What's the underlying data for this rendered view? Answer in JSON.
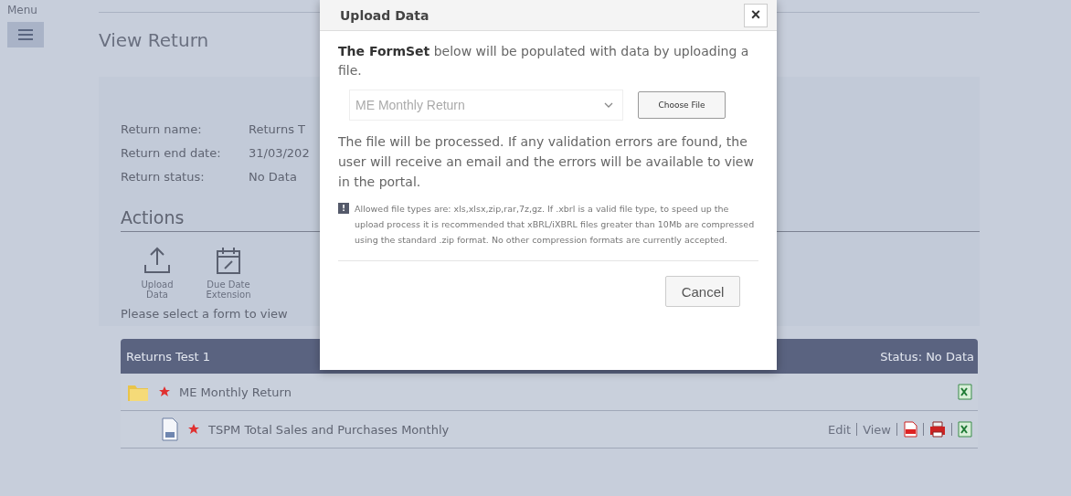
{
  "menu": {
    "label": "Menu"
  },
  "page": {
    "title": "View Return"
  },
  "details": [
    {
      "label": "Return name:",
      "value": "Returns T"
    },
    {
      "label": "Return end date:",
      "value": "31/03/202"
    },
    {
      "label": "Return status:",
      "value": "No Data"
    }
  ],
  "actions": {
    "title": "Actions",
    "items": [
      {
        "kind": "upload",
        "label": "Upload Data"
      },
      {
        "kind": "calendar",
        "label": "Due Date Extension"
      }
    ]
  },
  "prompt": "Please select a form to view",
  "formset": {
    "name": "Returns Test 1",
    "status": "Status: No Data",
    "rows": [
      {
        "kind": "folder",
        "name": "ME Monthly Return",
        "links": [],
        "exports": [
          {
            "kind": "excel"
          }
        ],
        "children": [
          {
            "kind": "document",
            "name": "TSPM Total Sales and Purchases Monthly",
            "links": [
              "Edit",
              "View"
            ],
            "exports": [
              {
                "kind": "pdf"
              },
              {
                "kind": "print"
              },
              {
                "kind": "excel"
              }
            ]
          }
        ]
      }
    ]
  },
  "dialog": {
    "title": "Upload Data",
    "close": "×",
    "intro": "**The FormSet** below will be populated with data by uploading a file.",
    "select": {
      "value": "ME Monthly Return"
    },
    "choose_button": "Choose File",
    "message": "The file will be processed. If any validation errors are found, the user will receive an email and the errors will be available to view in the portal.",
    "note_icon": "!",
    "note": "Allowed file types are: xls,xlsx,zip,rar,7z,gz. If .xbrl is a valid file type, to speed up the upload process it is recommended that xBRL/iXBRL files greater than 10Mb are compressed using the standard .zip format. No other compression formats are currently accepted.",
    "cancel_button": "Cancel"
  }
}
